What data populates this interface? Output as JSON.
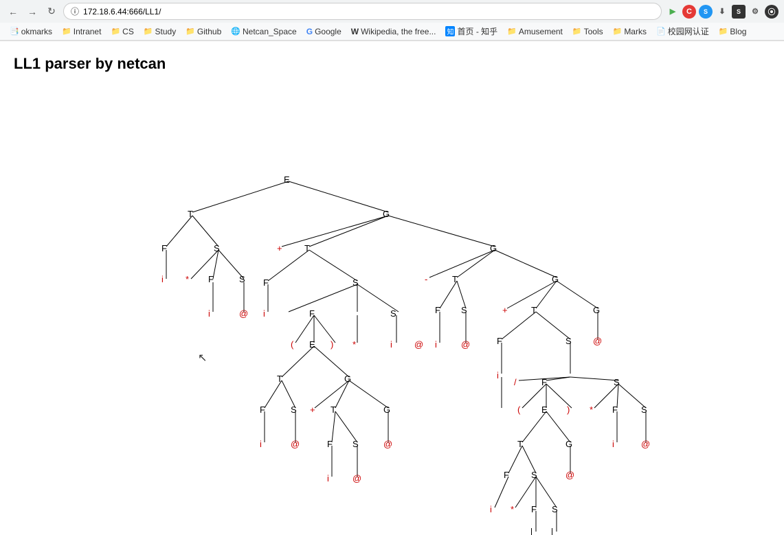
{
  "browser": {
    "url": "172.18.6.44:666/LL1/",
    "bookmarks": [
      {
        "label": "okmarks",
        "icon": "📑"
      },
      {
        "label": "Intranet",
        "icon": "📁"
      },
      {
        "label": "CS",
        "icon": "📁"
      },
      {
        "label": "Study",
        "icon": "📁"
      },
      {
        "label": "Github",
        "icon": "📁"
      },
      {
        "label": "Netcan_Space",
        "icon": "🌐"
      },
      {
        "label": "Google",
        "icon": "G"
      },
      {
        "label": "Wikipedia, the free...",
        "icon": "W"
      },
      {
        "label": "首页 - 知乎",
        "icon": "知"
      },
      {
        "label": "Amusement",
        "icon": "📁"
      },
      {
        "label": "Tools",
        "icon": "📁"
      },
      {
        "label": "Marks",
        "icon": "📁"
      },
      {
        "label": "校园网认证",
        "icon": "📄"
      },
      {
        "label": "Blog",
        "icon": "📁"
      }
    ]
  },
  "page": {
    "title": "LL1 parser by netcan"
  }
}
